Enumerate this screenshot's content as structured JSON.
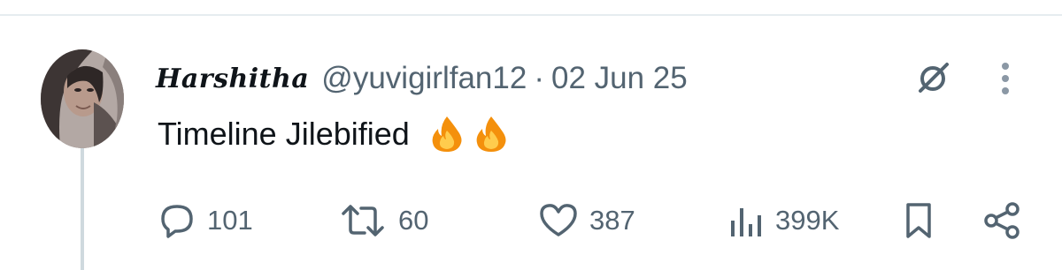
{
  "tweet": {
    "author": {
      "display_name": "Harshitha",
      "handle": "@yuvigirlfan12"
    },
    "separator": "·",
    "date": "02 Jun 25",
    "text": "Timeline Jilebified",
    "emojis": [
      "fire-emoji",
      "fire-emoji"
    ]
  },
  "actions": {
    "replies": "101",
    "reposts": "60",
    "likes": "387",
    "views": "399K"
  },
  "icons": {
    "reply": "reply-icon",
    "repost": "repost-icon",
    "like": "heart-icon",
    "views": "views-icon",
    "bookmark": "bookmark-icon",
    "share": "share-icon",
    "grok": "grok-icon",
    "more": "more-icon"
  },
  "colors": {
    "text_primary": "#0f1419",
    "text_secondary": "#536471",
    "divider": "#e6ecf0",
    "thread_line": "#cfd9de"
  }
}
